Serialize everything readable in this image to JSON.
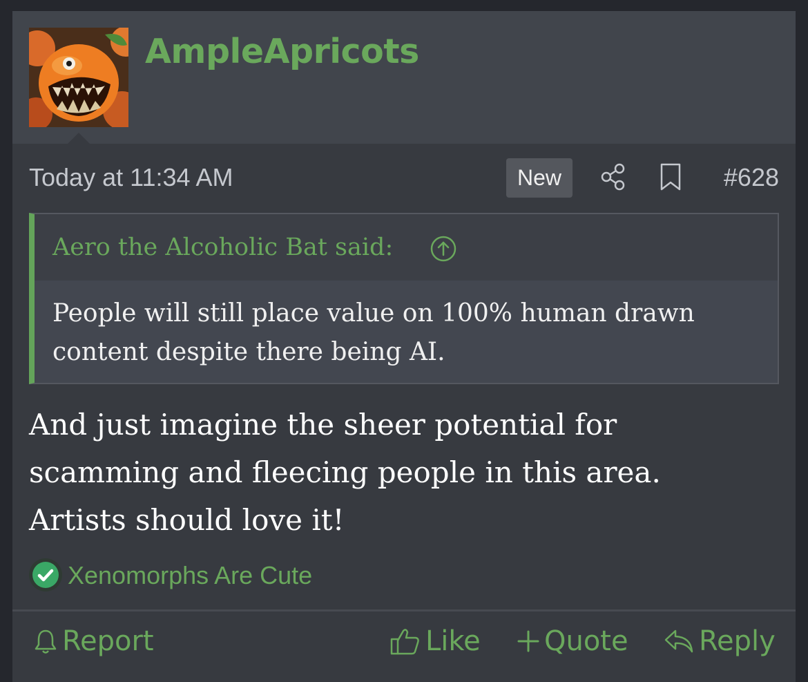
{
  "post": {
    "author": "AmpleApricots",
    "avatar_icon": "grinning-apricot-avatar",
    "date": "Today at 11:34 AM",
    "new_badge": "New",
    "post_number": "#628",
    "quote": {
      "author": "Aero the Alcoholic Bat said:",
      "text_line1": "People will still place value on 100% human drawn",
      "text_line2": "content despite there being AI."
    },
    "body_line1": "And just imagine the sheer potential for",
    "body_line2": "scamming and fleecing people in this area.",
    "body_line3": "Artists should love it!",
    "reaction": {
      "icon": "check-circle-icon",
      "users": "Xenomorphs Are Cute"
    },
    "actions": {
      "report": "Report",
      "like": "Like",
      "quote": "Quote",
      "reply": "Reply"
    }
  },
  "colors": {
    "accent": "#6aa85c",
    "background": "#373a40",
    "header_bg": "#41454c",
    "quote_bg": "#434750"
  }
}
